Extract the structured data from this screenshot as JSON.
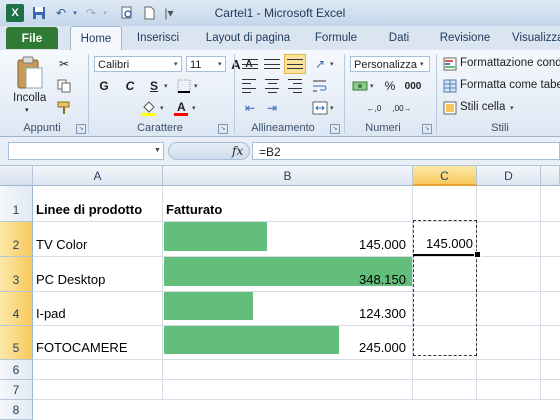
{
  "window": {
    "title": "Cartel1 - Microsoft Excel"
  },
  "quick_access": {
    "icons": [
      "excel-icon",
      "save-icon",
      "undo-icon",
      "redo-icon",
      "print-preview-icon",
      "new-icon",
      "customize-icon"
    ]
  },
  "ribbon": {
    "tabs": [
      "File",
      "Home",
      "Inserisci",
      "Layout di pagina",
      "Formule",
      "Dati",
      "Revisione",
      "Visualizza"
    ],
    "active_tab": "Home",
    "clipboard": {
      "label": "Appunti",
      "paste_label": "Incolla"
    },
    "font": {
      "label": "Carattere",
      "font_name": "Calibri",
      "font_size": "11",
      "bold": "G",
      "italic": "C",
      "underline": "S",
      "grow": "A",
      "shrink": "A"
    },
    "alignment": {
      "label": "Allineamento"
    },
    "number": {
      "label": "Numeri",
      "format": "Personalizza"
    },
    "styles": {
      "label": "Stili",
      "conditional": "Formattazione condizionale",
      "as_table": "Formatta come tabella",
      "cell_styles": "Stili cella"
    }
  },
  "formula_bar": {
    "name_box": "",
    "fx": "fx",
    "formula": "=B2"
  },
  "sheet": {
    "columns": [
      "A",
      "B",
      "C",
      "D"
    ],
    "rows": [
      "1",
      "2",
      "3",
      "4",
      "5",
      "6",
      "7",
      "8"
    ],
    "header_a": "Linee di prodotto",
    "header_b": "Fatturato",
    "data": [
      {
        "product": "TV Color",
        "revenue": "145.000",
        "bar_fraction": 0.4165
      },
      {
        "product": "PC Desktop",
        "revenue": "348.150",
        "bar_fraction": 1.0
      },
      {
        "product": "I-pad",
        "revenue": "124.300",
        "bar_fraction": 0.357
      },
      {
        "product": "FOTOCAMERE",
        "revenue": "245.000",
        "bar_fraction": 0.7037
      }
    ],
    "c2_value": "145.000",
    "bar_color": "#63be7b"
  }
}
